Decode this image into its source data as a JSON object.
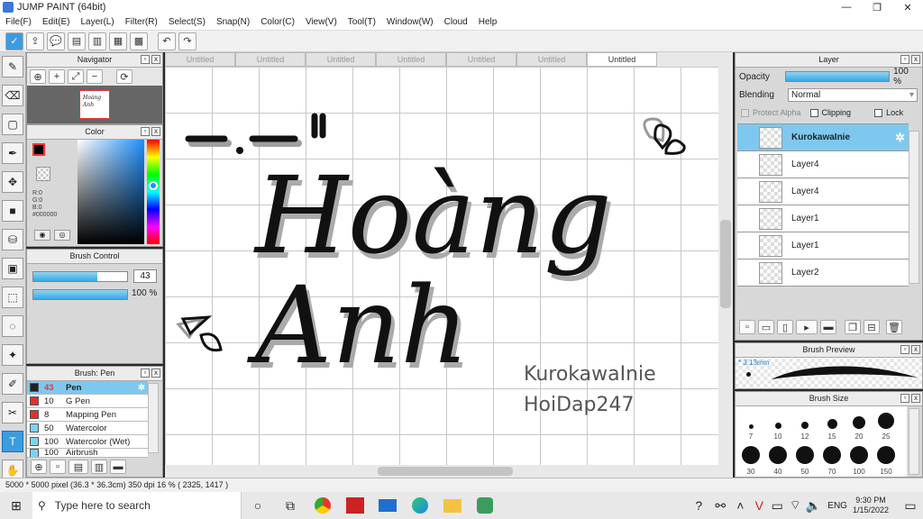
{
  "window": {
    "title": "JUMP PAINT (64bit)",
    "minimize": "—",
    "maximize": "❐",
    "close": "✕"
  },
  "menu": [
    "File(F)",
    "Edit(E)",
    "Layer(L)",
    "Filter(R)",
    "Select(S)",
    "Snap(N)",
    "Color(C)",
    "View(V)",
    "Tool(T)",
    "Window(W)",
    "Cloud",
    "Help"
  ],
  "tabs": [
    "Untitled",
    "Untitled",
    "Untitled",
    "Untitled",
    "Untitled",
    "Untitled",
    "Untitled"
  ],
  "navigator": {
    "title": "Navigator",
    "thumb_text": "Hoàng Anh"
  },
  "color": {
    "title": "Color",
    "r": "R:0",
    "g": "G:0",
    "b": "B:0",
    "hex": "#000000",
    "accent": "#000000"
  },
  "brush_control": {
    "title": "Brush Control",
    "size": "43",
    "opacity": "100 %",
    "size_fill": 0.68,
    "opacity_fill": 1.0
  },
  "brush_list": {
    "title": "Brush: Pen",
    "items": [
      {
        "size": "43",
        "name": "Pen",
        "color": "#222222"
      },
      {
        "size": "10",
        "name": "G Pen",
        "color": "#e03030"
      },
      {
        "size": "8",
        "name": "Mapping Pen",
        "color": "#e03030"
      },
      {
        "size": "50",
        "name": "Watercolor",
        "color": "#7fd3f0"
      },
      {
        "size": "100",
        "name": "Watercolor (Wet)",
        "color": "#7fd3f0"
      },
      {
        "size": "100",
        "name": "Airbrush",
        "color": "#7fd3f0"
      }
    ]
  },
  "layer_panel": {
    "title": "Layer",
    "opacity_label": "Opacity",
    "opacity_value": "100 %",
    "blending_label": "Blending",
    "blending_value": "Normal",
    "protect_alpha": "Protect Alpha",
    "clipping": "Clipping",
    "lock": "Lock",
    "layers": [
      "KurokawaInie",
      "Layer4",
      "Layer4",
      "Layer1",
      "Layer1",
      "Layer2"
    ]
  },
  "brush_preview": {
    "title": "Brush Preview",
    "size_label": "* 3.13mm"
  },
  "brush_size": {
    "title": "Brush Size",
    "sizes": [
      "7",
      "10",
      "12",
      "15",
      "20",
      "25",
      "30",
      "40",
      "50",
      "70",
      "100",
      "150"
    ]
  },
  "canvas": {
    "text_main1": "Hoàng",
    "text_main2": "Anh",
    "credit1": "KurokawaInie",
    "credit2": "HoiDap247"
  },
  "status": "5000 * 5000 pixel  (36.3 * 36.3cm)  350 dpi  16 %  ( 2325, 1417 )",
  "taskbar": {
    "search_placeholder": "Type here to search",
    "time": "9:30 PM",
    "date": "1/15/2022",
    "lang": "ENG"
  }
}
